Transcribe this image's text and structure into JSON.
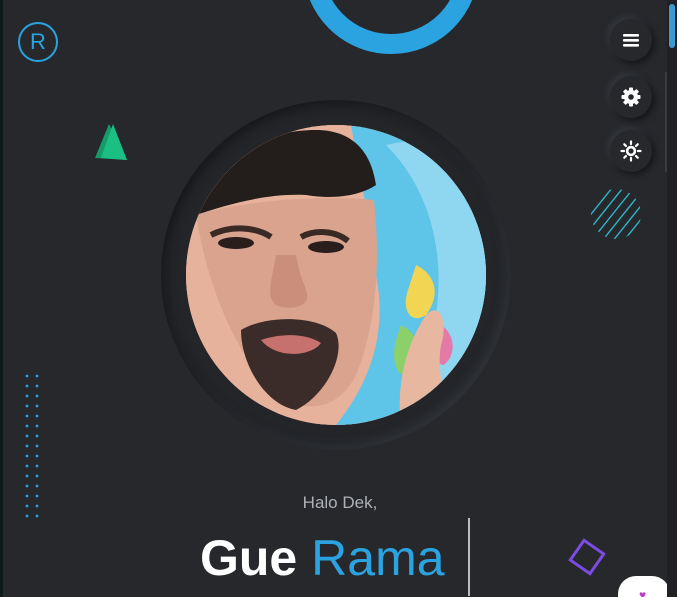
{
  "header": {
    "logo_letter": "R"
  },
  "controls": {
    "menu_icon": "hamburger-icon",
    "settings_icon": "gear-icon",
    "theme_icon": "sun-icon"
  },
  "hero": {
    "greeting": "Halo Dek,",
    "name_first": "Gue",
    "name_second": "Rama"
  },
  "colors": {
    "accent": "#2aa3e0",
    "background": "#26282c",
    "triangle": "#1bbf83",
    "square": "#7b4ce2",
    "stripes": "#2fb6c9"
  }
}
